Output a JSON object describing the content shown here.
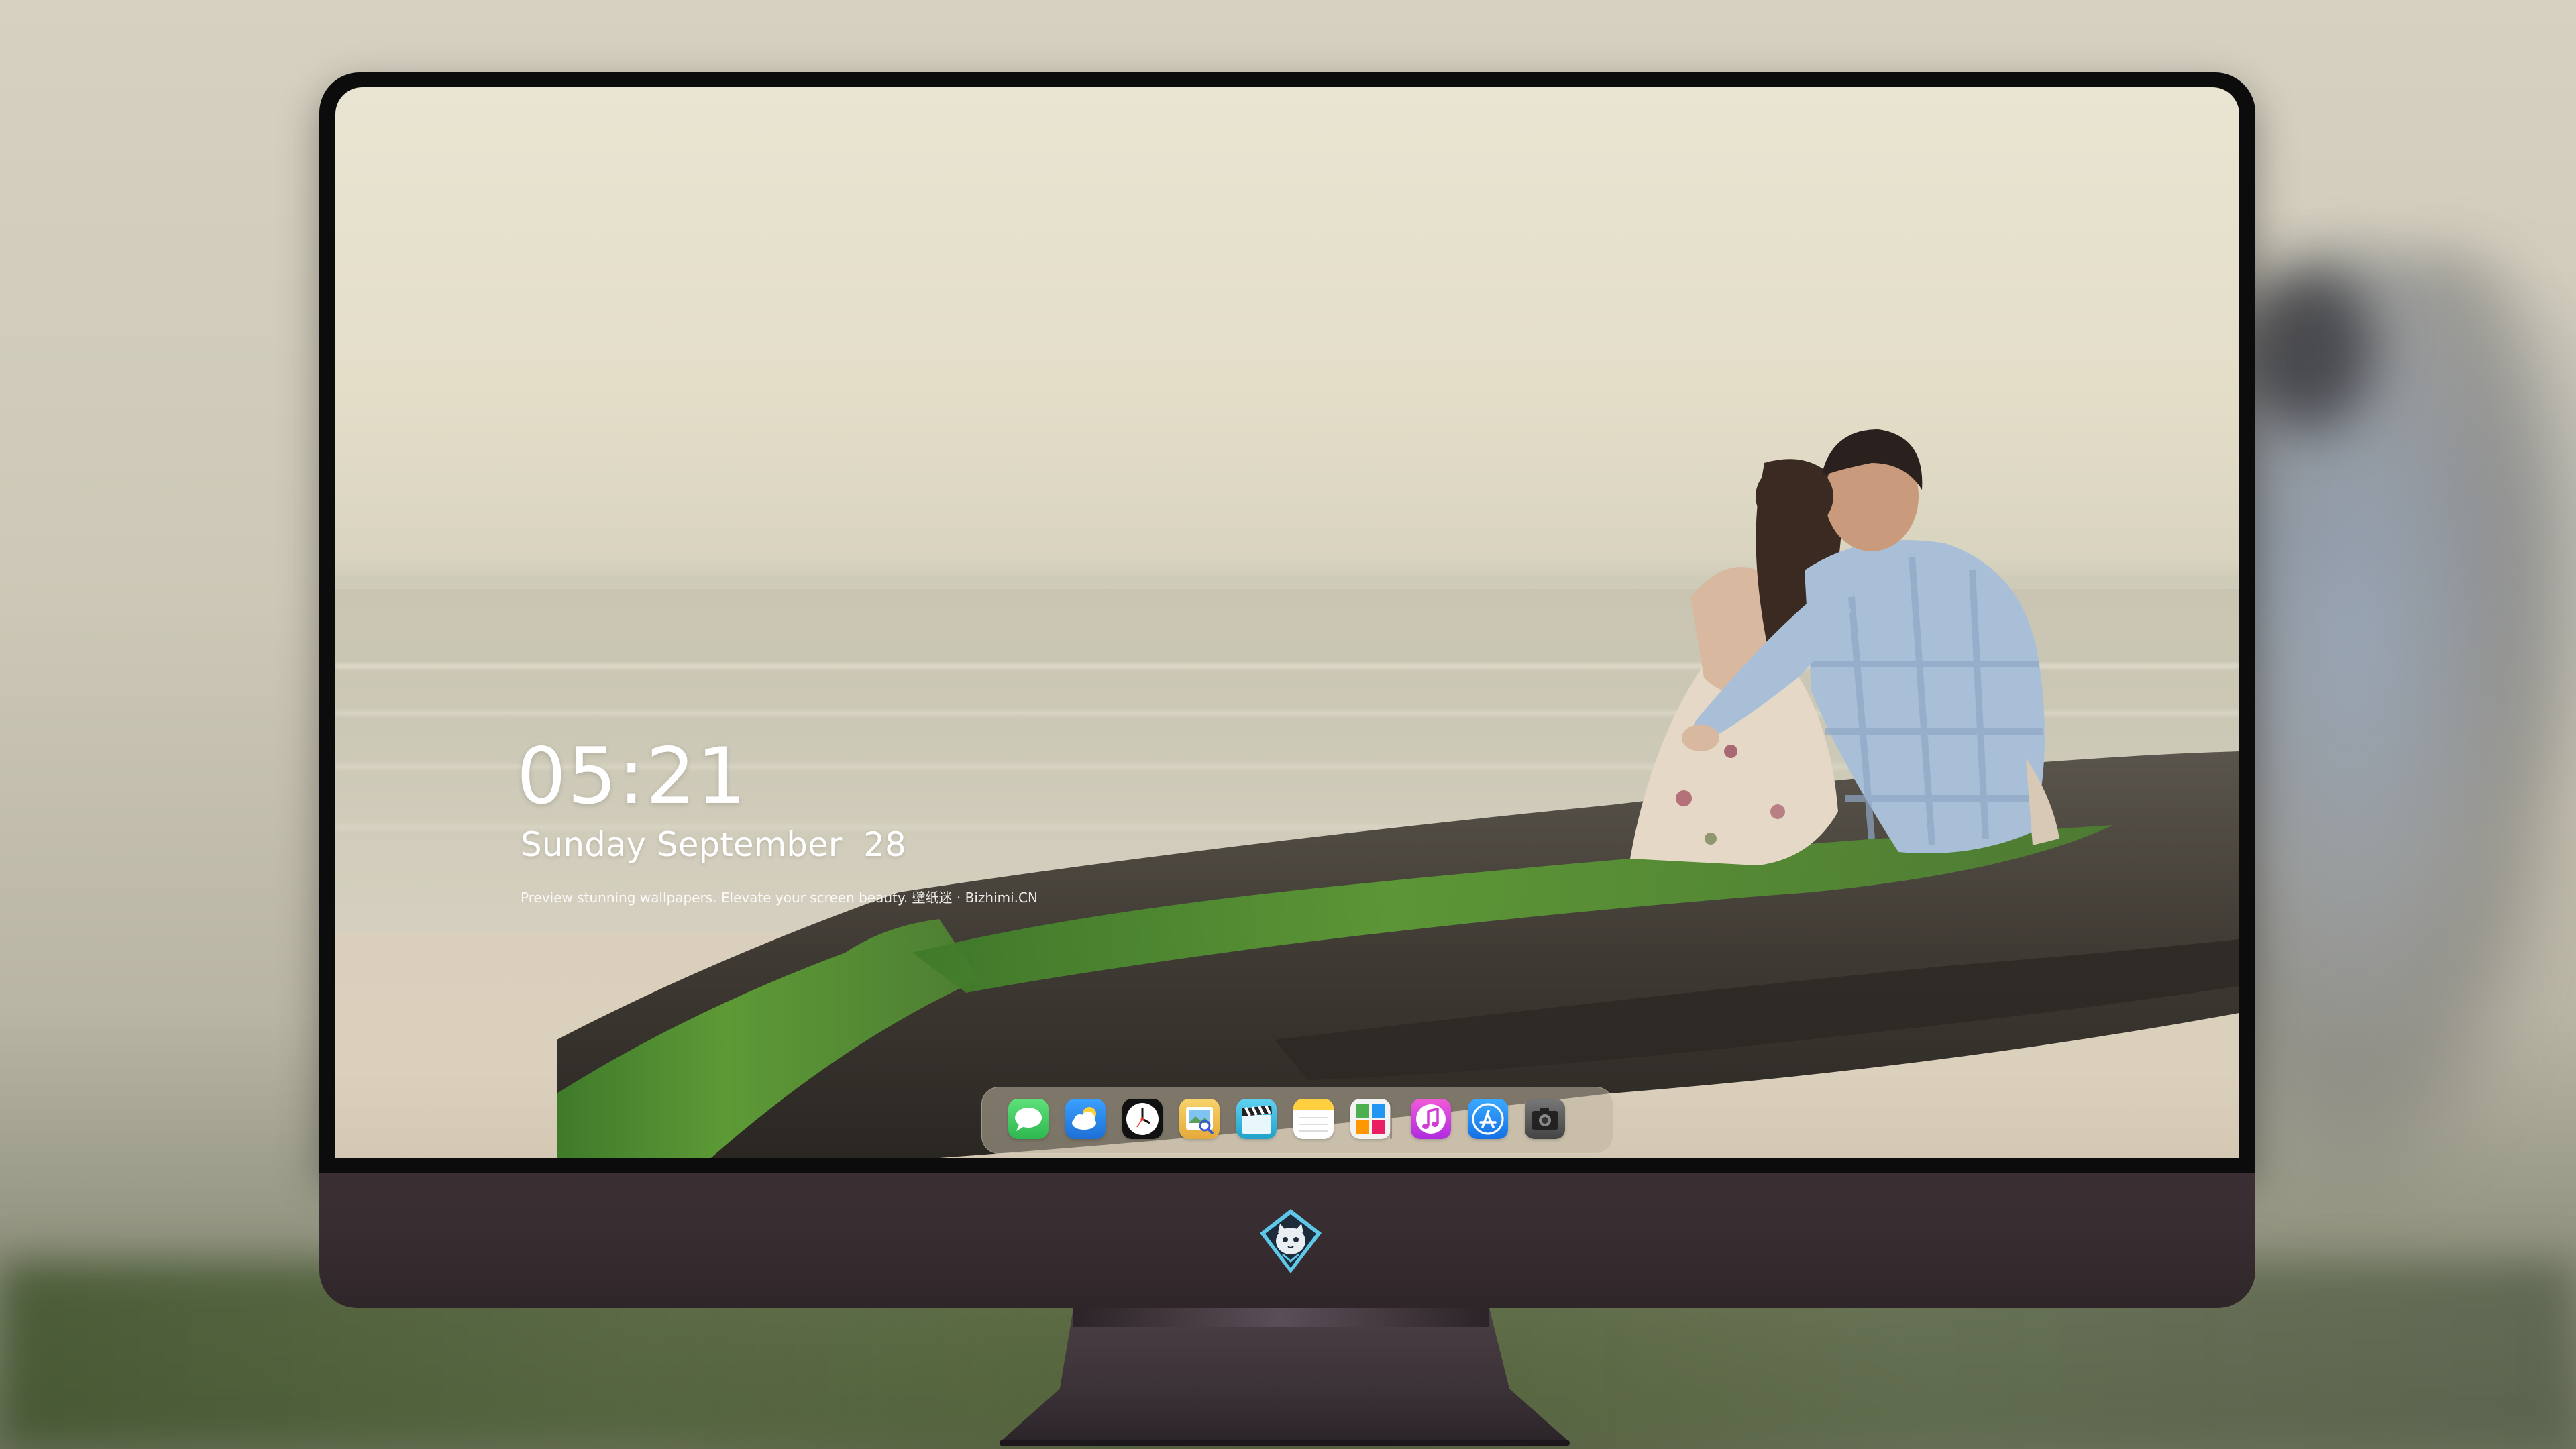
{
  "lock_screen": {
    "time": "05:21",
    "date": "Sunday September  28",
    "tagline": "Preview stunning wallpapers. Elevate your screen beauty. 壁纸迷 · Bizhimi.CN"
  },
  "dock": {
    "apps": [
      {
        "name": "Messages",
        "icon": "messages-icon",
        "color": "#34c759"
      },
      {
        "name": "Weather",
        "icon": "weather-icon",
        "color": "#2f8ff0"
      },
      {
        "name": "Clock",
        "icon": "clock-icon",
        "color": "#111111"
      },
      {
        "name": "Preview",
        "icon": "preview-icon",
        "color": "#f2c14e"
      },
      {
        "name": "Clips",
        "icon": "clapperboard-icon",
        "color": "#2bb3d8"
      },
      {
        "name": "Notes",
        "icon": "notes-icon",
        "color": "#ffd34e"
      },
      {
        "name": "Photo Booth",
        "icon": "photo-grid-icon",
        "color": "#e8e8e8"
      },
      {
        "name": "Music",
        "icon": "music-icon",
        "color": "#e040c8"
      },
      {
        "name": "App Store",
        "icon": "app-store-icon",
        "color": "#1a8cff"
      },
      {
        "name": "Camera",
        "icon": "camera-icon",
        "color": "#5b5b5b"
      }
    ]
  },
  "monitor": {
    "logo_icon": "cat-diamond-logo-icon",
    "chin_color": "#3b2f33"
  }
}
